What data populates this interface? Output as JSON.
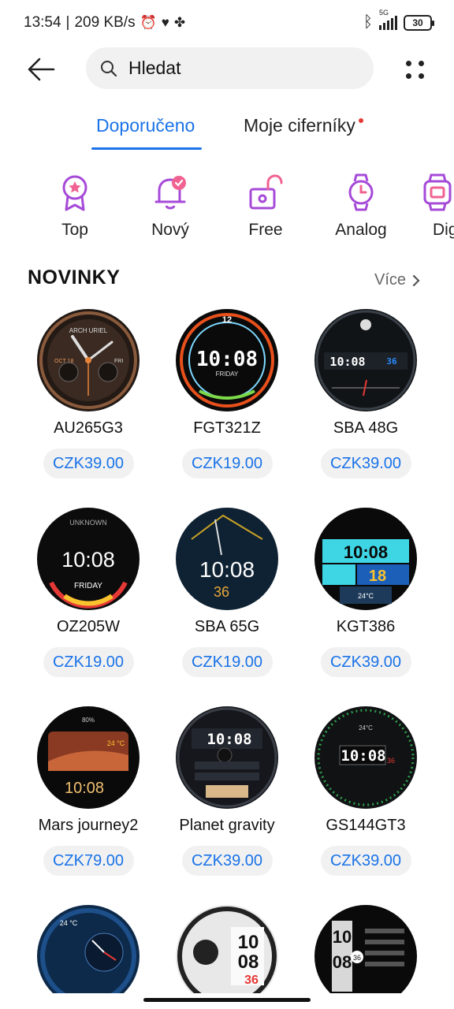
{
  "status_bar": {
    "time": "13:54",
    "speed": "209 KB/s",
    "network": "5G",
    "battery": "30"
  },
  "header": {
    "search_placeholder": "Hledat"
  },
  "tabs": [
    {
      "label": "Doporučeno",
      "active": true
    },
    {
      "label": "Moje ciferníky",
      "active": false,
      "badge": true
    }
  ],
  "categories": [
    {
      "label": "Top",
      "icon": "medal-icon"
    },
    {
      "label": "Nový",
      "icon": "bell-icon"
    },
    {
      "label": "Free",
      "icon": "unlock-icon"
    },
    {
      "label": "Analog",
      "icon": "watch-icon"
    },
    {
      "label": "Dig",
      "icon": "digital-watch-icon"
    }
  ],
  "section": {
    "title": "NOVINKY",
    "more_label": "Více"
  },
  "watch_faces": [
    {
      "name": "AU265G3",
      "price": "CZK39.00",
      "face_time": "ARCH URIEL",
      "style": "analog-bronze"
    },
    {
      "name": "FGT321Z",
      "price": "CZK19.00",
      "face_time": "10:08",
      "style": "digital-orange"
    },
    {
      "name": "SBA 48G",
      "price": "CZK39.00",
      "face_time": "10:08",
      "style": "digital-dark"
    },
    {
      "name": "OZ205W",
      "price": "CZK19.00",
      "face_time": "10:08",
      "style": "digital-rainbow"
    },
    {
      "name": "SBA 65G",
      "price": "CZK19.00",
      "face_time": "10:08",
      "style": "digital-gold"
    },
    {
      "name": "KGT386",
      "price": "CZK39.00",
      "face_time": "10:08",
      "style": "digital-cyan"
    },
    {
      "name": "Mars journey2",
      "price": "CZK79.00",
      "face_time": "10:08",
      "style": "mars"
    },
    {
      "name": "Planet gravity",
      "price": "CZK39.00",
      "face_time": "10:08",
      "style": "planet"
    },
    {
      "name": "GS144GT3",
      "price": "CZK39.00",
      "face_time": "10:08",
      "style": "digital-green"
    },
    {
      "name": "",
      "price": "",
      "face_time": "",
      "style": "analog-blue"
    },
    {
      "name": "",
      "price": "",
      "face_time": "10 08 36",
      "style": "digital-white"
    },
    {
      "name": "",
      "price": "",
      "face_time": "10 08 36",
      "style": "digital-bw"
    }
  ],
  "colors": {
    "accent": "#1a73e8",
    "category_icon": "#a64ad8",
    "badge": "#e53935"
  }
}
